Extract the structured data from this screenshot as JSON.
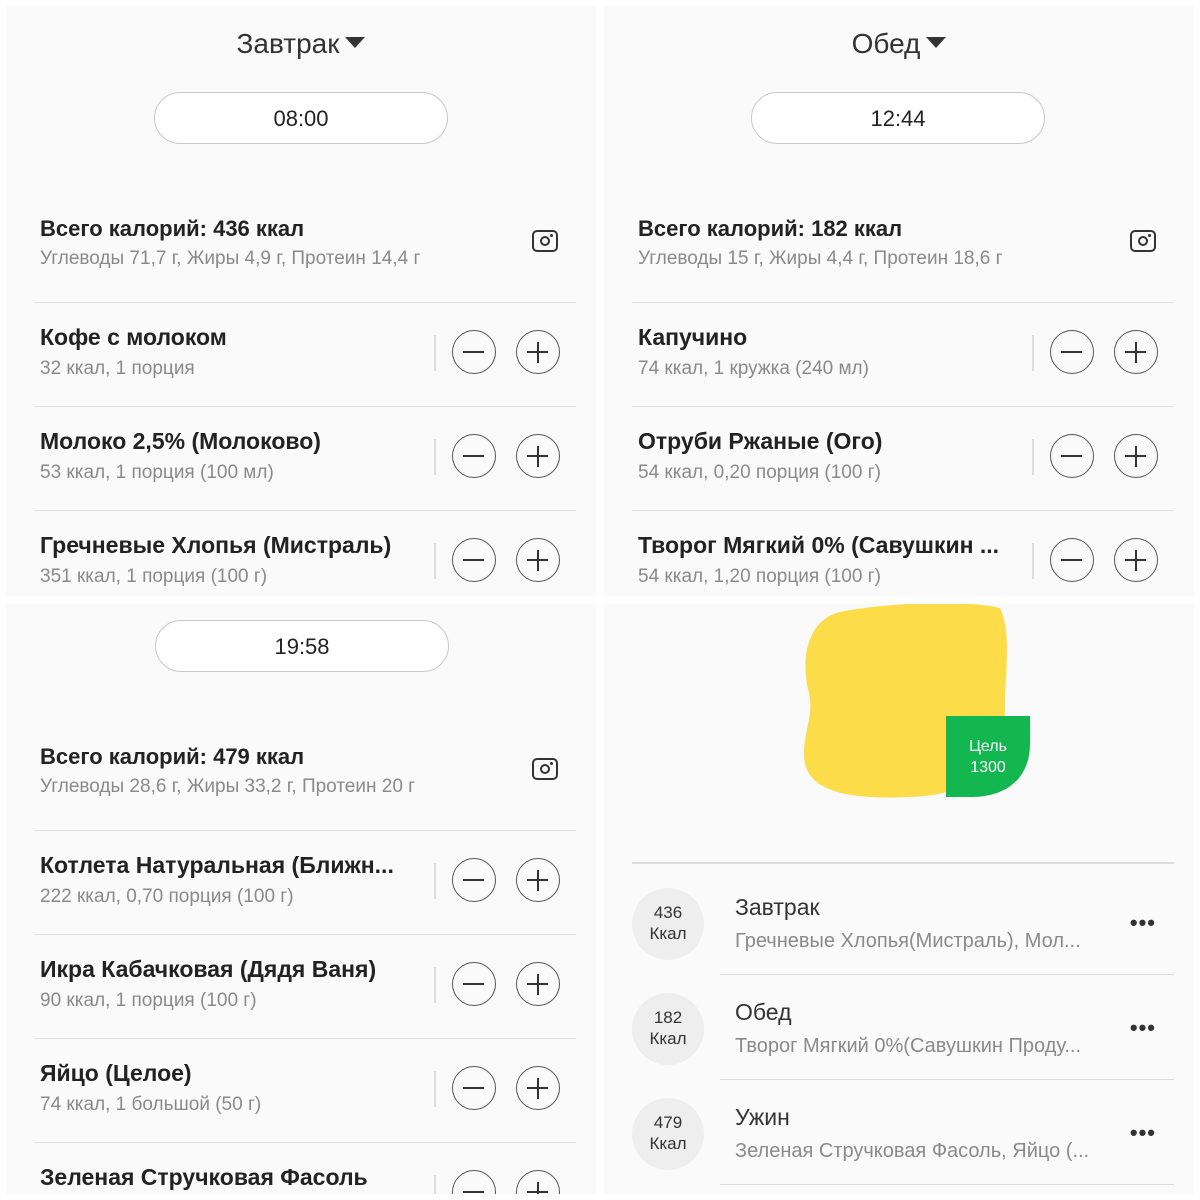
{
  "breakfast": {
    "title": "Завтрак",
    "time": "08:00",
    "total_title": "Всего калорий: 436 ккал",
    "total_macros": "Углеводы 71,7 г, Жиры 4,9 г, Протеин 14,4 г",
    "items": [
      {
        "name": "Кофе с молоком",
        "detail": "32 ккал, 1 порция"
      },
      {
        "name": "Молоко 2,5% (Молоково)",
        "detail": "53 ккал, 1 порция (100 мл)"
      },
      {
        "name": "Гречневые Хлопья (Мистраль)",
        "detail": "351 ккал, 1 порция (100 г)"
      }
    ]
  },
  "lunch": {
    "title": "Обед",
    "time": "12:44",
    "total_title": "Всего калорий: 182 ккал",
    "total_macros": "Углеводы 15 г, Жиры 4,4 г, Протеин 18,6 г",
    "items": [
      {
        "name": "Капучино",
        "detail": "74 ккал, 1 кружка (240 мл)"
      },
      {
        "name": "Отруби Ржаные (Ого)",
        "detail": "54 ккал, 0,20 порция (100 г)"
      },
      {
        "name": "Творог Мягкий 0% (Савушкин ...",
        "detail": "54 ккал, 1,20 порция (100 г)"
      }
    ]
  },
  "dinner": {
    "time": "19:58",
    "total_title": "Всего калорий: 479 ккал",
    "total_macros": "Углеводы 28,6 г, Жиры 33,2 г, Протеин 20 г",
    "items": [
      {
        "name": "Котлета Натуральная (Ближн...",
        "detail": "222 ккал, 0,70 порция (100 г)"
      },
      {
        "name": "Икра Кабачковая (Дядя Ваня)",
        "detail": "90 ккал, 1 порция (100 г)"
      },
      {
        "name": "Яйцо (Целое)",
        "detail": "74 ккал, 1 большой (50 г)"
      },
      {
        "name": "Зеленая Стручковая Фасоль",
        "detail": ""
      }
    ]
  },
  "summary": {
    "goal_label": "Цель",
    "goal_value": "1300",
    "colors": {
      "lemon": "#fddc4a",
      "goal_badge": "#12b74f"
    },
    "meals": [
      {
        "kcal": "436",
        "unit": "Ккал",
        "name": "Завтрак",
        "items": "Гречневые Хлопья(Мистраль), Мол..."
      },
      {
        "kcal": "182",
        "unit": "Ккал",
        "name": "Обед",
        "items": "Творог Мягкий 0%(Савушкин Проду..."
      },
      {
        "kcal": "479",
        "unit": "Ккал",
        "name": "Ужин",
        "items": "Зеленая Стручковая Фасоль, Яйцо (..."
      }
    ]
  }
}
